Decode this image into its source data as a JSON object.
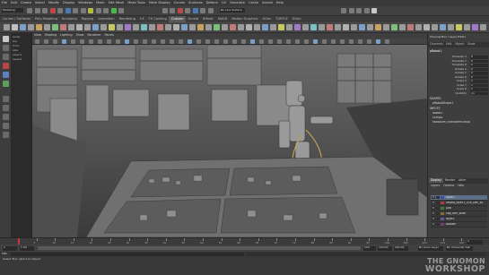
{
  "menubar": {
    "items": [
      "File",
      "Edit",
      "Create",
      "Select",
      "Modify",
      "Display",
      "Windows",
      "Mesh",
      "Edit Mesh",
      "Mesh Tools",
      "Mesh Display",
      "Curves",
      "Surfaces",
      "Deform",
      "UV",
      "Generate",
      "Cache",
      "Arnold",
      "Help"
    ],
    "mode_menu": "Modeling",
    "live_label": "No Live Surface"
  },
  "shelf": {
    "tabs": [
      "Curves / Surfaces",
      "Poly Modeling",
      "Sculpting",
      "Rigging",
      "Animation",
      "Rendering",
      "FX",
      "FX Caching",
      "Custom",
      "Arnold",
      "Bifrost",
      "MASH",
      "Motion Graphics",
      "XGen",
      "TURTLE",
      "XGen"
    ],
    "active_tab_index": 8
  },
  "outliner": {
    "items": [
      "persp",
      "top",
      "front",
      "side",
      "Layer1",
      "Layer2"
    ]
  },
  "viewport": {
    "menus": [
      "View",
      "Shading",
      "Lighting",
      "Show",
      "Renderer",
      "Panels"
    ]
  },
  "channel_box": {
    "tabs": [
      "Channels",
      "Edit",
      "Object",
      "Show"
    ],
    "panel_title": "Channel Box / Layer Editor",
    "object_name": "pRobot1",
    "attributes": [
      {
        "name": "Translate X",
        "value": "0"
      },
      {
        "name": "Translate Y",
        "value": "0"
      },
      {
        "name": "Translate Z",
        "value": "0"
      },
      {
        "name": "Rotate X",
        "value": "0"
      },
      {
        "name": "Rotate Y",
        "value": "0"
      },
      {
        "name": "Rotate Z",
        "value": "0"
      },
      {
        "name": "Scale X",
        "value": "1"
      },
      {
        "name": "Scale Y",
        "value": "1"
      },
      {
        "name": "Scale Z",
        "value": "1"
      },
      {
        "name": "Visibility",
        "value": "on"
      }
    ],
    "shapes_label": "SHAPES",
    "shape_name": "pRobotShape1",
    "inputs_label": "INPUTS",
    "inputs": [
      "Robot1",
      "Group1",
      "robotArm_transformGroup"
    ]
  },
  "layer_editor": {
    "tabs": [
      "Display",
      "Render",
      "Anim"
    ],
    "menu": [
      "Layers",
      "Options",
      "Help"
    ],
    "layers": [
      {
        "name": "layer1",
        "visible": "V",
        "color": "#3a4fa8",
        "selected": true
      },
      {
        "name": "Studio_layer1_01e_Dec_xx",
        "visible": "V",
        "color": "#b33a3a",
        "selected": false
      },
      {
        "name": "Dial",
        "visible": "V",
        "color": "#3a7a3a",
        "selected": false
      },
      {
        "name": "cap_arm_slide",
        "visible": "V",
        "color": "#8a6a2a",
        "selected": false
      },
      {
        "name": "layer1",
        "visible": "V",
        "color": "#5a5a9a",
        "selected": false
      },
      {
        "name": "Bottom",
        "visible": "V",
        "color": "#7a3a7a",
        "selected": false
      }
    ]
  },
  "timeline": {
    "ticks": [
      "5",
      "10",
      "15",
      "20",
      "25",
      "30",
      "35",
      "40",
      "45",
      "50",
      "55",
      "60",
      "65",
      "70",
      "75",
      "80",
      "85",
      "90",
      "95",
      "100",
      "105",
      "110",
      "115",
      "120"
    ],
    "current_frame": "1"
  },
  "range": {
    "start": "1",
    "inner_start": "1.00",
    "inner_end": "120",
    "end": "120.00",
    "end2": "200.00",
    "anim_layer": "No Anim Layer",
    "char_set": "No Character Set"
  },
  "command": {
    "label": "MEL"
  },
  "help": {
    "text": "Select Tool: select an object"
  },
  "watermark": {
    "line1": "THE GNOMON",
    "line2": "WORKSHOP"
  },
  "colors": {
    "accent_blue": "#5d6f89",
    "timeline_marker": "#c43a3a",
    "shelf_active": "#5a5a5a"
  }
}
